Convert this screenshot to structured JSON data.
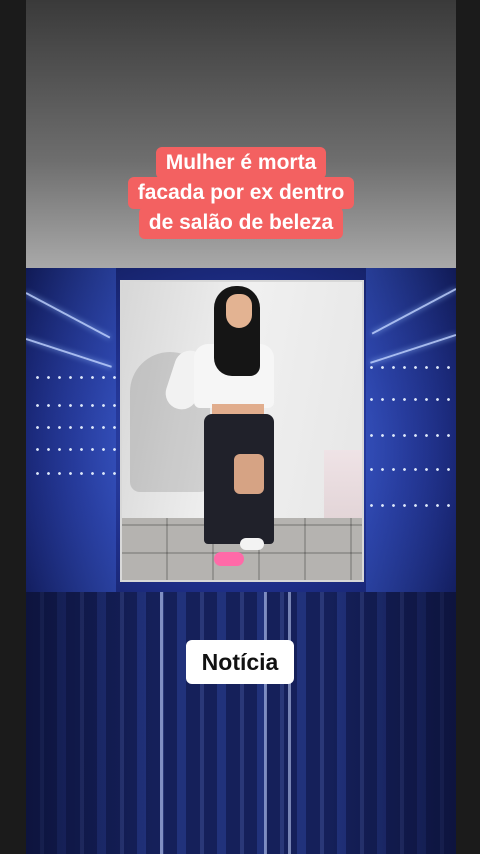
{
  "headline": {
    "lines": [
      "Mulher é morta",
      "facada por ex dentro",
      "de salão de beleza"
    ]
  },
  "tag": {
    "label": "Notícia"
  },
  "colors": {
    "headline_bg": "#f36161",
    "studio_blue": "#2a3ea8",
    "tag_bg": "#ffffff"
  }
}
